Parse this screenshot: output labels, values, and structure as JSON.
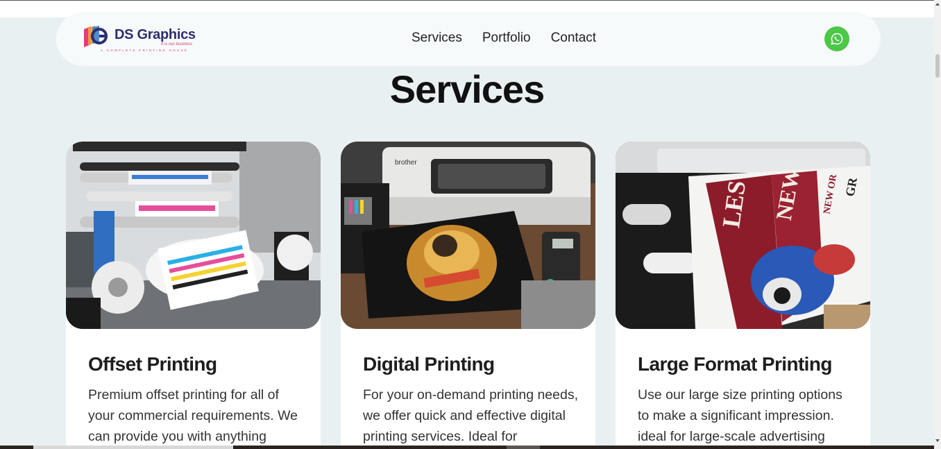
{
  "brand": {
    "name": "DS Graphics",
    "tagline": "It is our business",
    "subtitle": "A COMPLETE PRINTING HOUSE"
  },
  "nav": {
    "links": [
      {
        "label": "Services"
      },
      {
        "label": "Portfolio"
      },
      {
        "label": "Contact"
      }
    ],
    "whatsapp_icon": "whatsapp-icon"
  },
  "section": {
    "title": "Services"
  },
  "cards": [
    {
      "title": "Offset Printing",
      "text": "Premium offset printing for all of your commercial requirements. We can provide you with anything",
      "image": "offset-press-photo"
    },
    {
      "title": "Digital Printing",
      "text": "For your on-demand printing needs, we offer quick and effective digital printing services. Ideal for",
      "image": "dtg-printer-photo"
    },
    {
      "title": "Large Format Printing",
      "text": "Use our large size printing options to make a significant impression. ideal for large-scale advertising",
      "image": "large-format-printer-photo"
    }
  ],
  "colors": {
    "page_bg": "#e9f0f2",
    "navbar_bg": "#f7fafb",
    "whatsapp_green": "#4cc747",
    "brand_navy": "#2b2f6e",
    "brand_pink": "#d43a7a"
  }
}
